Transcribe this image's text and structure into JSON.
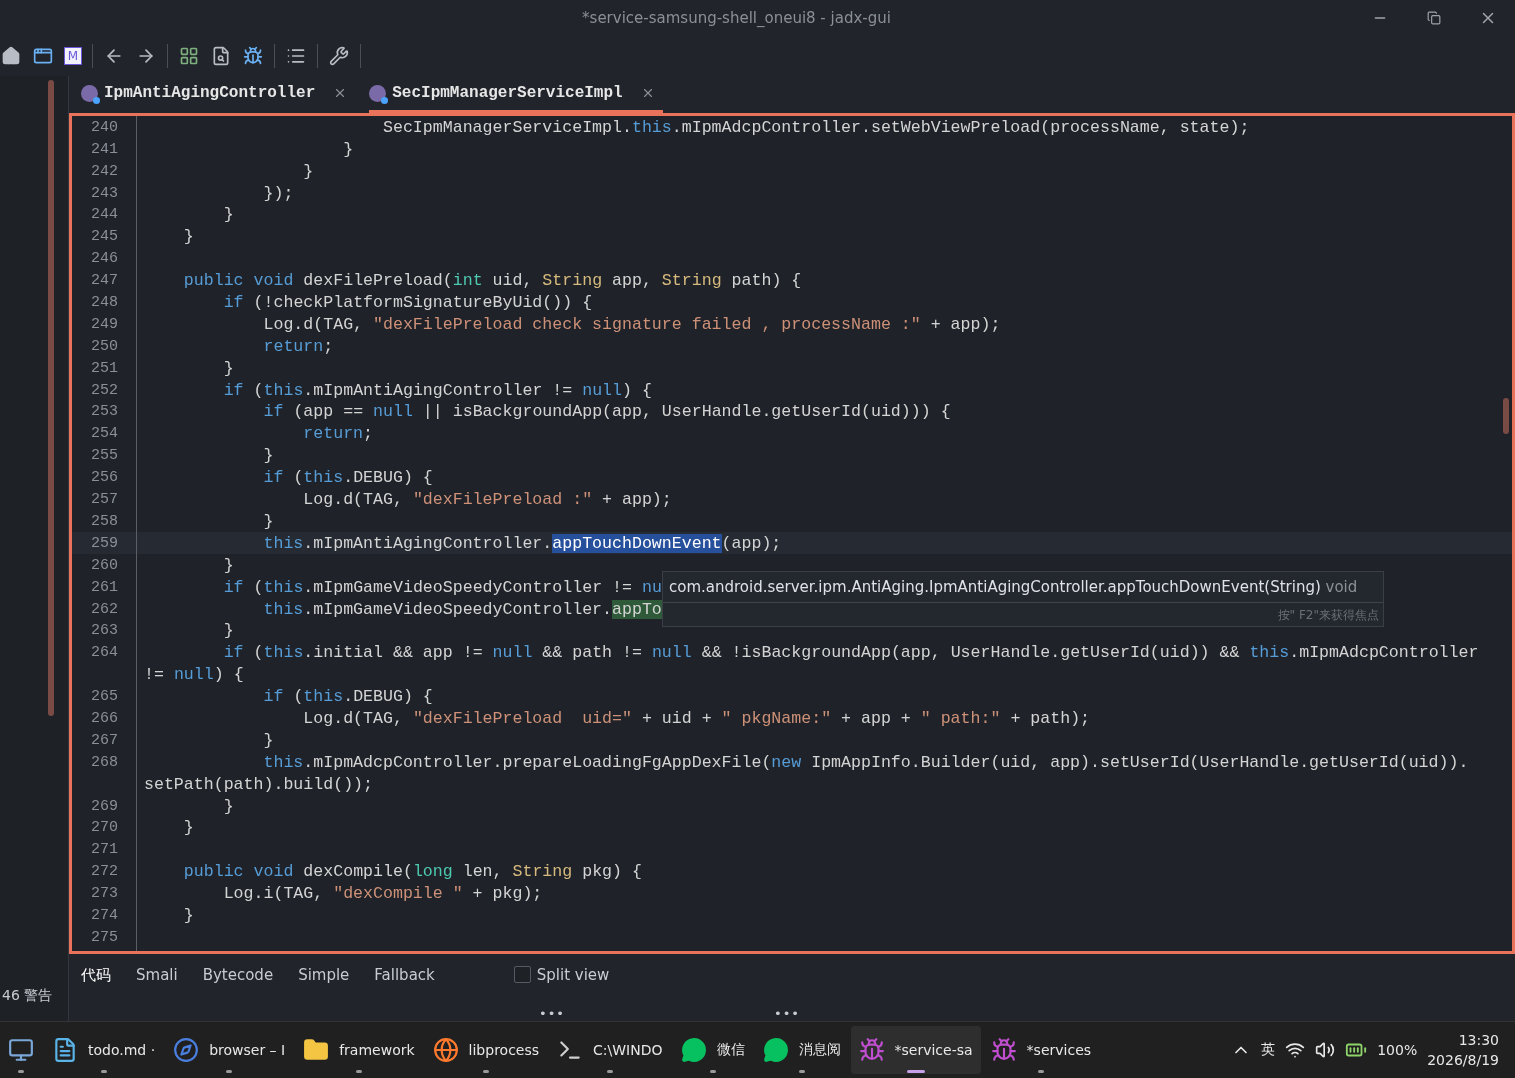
{
  "window": {
    "title": "*service-samsung-shell_oneui8 - jadx-gui"
  },
  "toolbar": [
    {
      "kind": "home"
    },
    {
      "kind": "window"
    },
    {
      "kind": "letter",
      "text": "M"
    },
    {
      "kind": "sep"
    },
    {
      "kind": "back"
    },
    {
      "kind": "forward"
    },
    {
      "kind": "sep"
    },
    {
      "kind": "grid"
    },
    {
      "kind": "search"
    },
    {
      "kind": "bug"
    },
    {
      "kind": "sep"
    },
    {
      "kind": "list"
    },
    {
      "kind": "sep"
    },
    {
      "kind": "wrench"
    },
    {
      "kind": "sep"
    }
  ],
  "tabs": [
    {
      "label": "IpmAntiAgingController",
      "selected": false
    },
    {
      "label": "SecIpmManagerServiceImpl",
      "selected": true
    }
  ],
  "editor": {
    "lines": [
      {
        "number": "240",
        "segments": [
          {
            "kind": "plain",
            "text": "                        SecIpmManagerServiceImpl."
          },
          {
            "kind": "kw",
            "text": "this"
          },
          {
            "kind": "plain",
            "text": ".mIpmAdcpController.setWebViewPreload(processName, state);"
          }
        ]
      },
      {
        "number": "241",
        "segments": [
          {
            "kind": "plain",
            "text": "                    }"
          }
        ]
      },
      {
        "number": "242",
        "segments": [
          {
            "kind": "plain",
            "text": "                }"
          }
        ]
      },
      {
        "number": "243",
        "segments": [
          {
            "kind": "plain",
            "text": "            });"
          }
        ]
      },
      {
        "number": "244",
        "segments": [
          {
            "kind": "plain",
            "text": "        }"
          }
        ]
      },
      {
        "number": "245",
        "segments": [
          {
            "kind": "plain",
            "text": "    }"
          }
        ]
      },
      {
        "number": "246"
      },
      {
        "number": "247",
        "segments": [
          {
            "kind": "kw",
            "text": "    public"
          },
          {
            "kind": "kw",
            "text": " void"
          },
          {
            "kind": "plain",
            "text": " dexFilePreload("
          },
          {
            "kind": "prim",
            "text": "int"
          },
          {
            "kind": "plain",
            "text": " uid, "
          },
          {
            "kind": "type",
            "text": "String"
          },
          {
            "kind": "plain",
            "text": " app, "
          },
          {
            "kind": "type",
            "text": "String"
          },
          {
            "kind": "plain",
            "text": " path) {"
          }
        ]
      },
      {
        "number": "248",
        "segments": [
          {
            "kind": "kw",
            "text": "        if"
          },
          {
            "kind": "plain",
            "text": " (!checkPlatformSignatureByUid()) {"
          }
        ]
      },
      {
        "number": "249",
        "segments": [
          {
            "kind": "plain",
            "text": "            Log.d(TAG, "
          },
          {
            "kind": "str",
            "text": "\"dexFilePreload check signature failed , processName :\""
          },
          {
            "kind": "plain",
            "text": " + app);"
          }
        ]
      },
      {
        "number": "250",
        "segments": [
          {
            "kind": "kw",
            "text": "            return"
          },
          {
            "kind": "plain",
            "text": ";"
          }
        ]
      },
      {
        "number": "251",
        "segments": [
          {
            "kind": "plain",
            "text": "        }"
          }
        ]
      },
      {
        "number": "252",
        "segments": [
          {
            "kind": "kw",
            "text": "        if"
          },
          {
            "kind": "plain",
            "text": " ("
          },
          {
            "kind": "kw",
            "text": "this"
          },
          {
            "kind": "plain",
            "text": ".mIpmAntiAgingController != "
          },
          {
            "kind": "kw",
            "text": "null"
          },
          {
            "kind": "plain",
            "text": ") {"
          }
        ]
      },
      {
        "number": "253",
        "segments": [
          {
            "kind": "kw",
            "text": "            if"
          },
          {
            "kind": "plain",
            "text": " (app == "
          },
          {
            "kind": "kw",
            "text": "null"
          },
          {
            "kind": "plain",
            "text": " || isBackgroundApp(app, UserHandle.getUserId(uid))) {"
          }
        ]
      },
      {
        "number": "254",
        "segments": [
          {
            "kind": "kw",
            "text": "                return"
          },
          {
            "kind": "plain",
            "text": ";"
          }
        ]
      },
      {
        "number": "255",
        "segments": [
          {
            "kind": "plain",
            "text": "            }"
          }
        ]
      },
      {
        "number": "256",
        "segments": [
          {
            "kind": "kw",
            "text": "            if"
          },
          {
            "kind": "plain",
            "text": " ("
          },
          {
            "kind": "kw",
            "text": "this"
          },
          {
            "kind": "plain",
            "text": ".DEBUG) {"
          }
        ]
      },
      {
        "number": "257",
        "segments": [
          {
            "kind": "plain",
            "text": "                Log.d(TAG, "
          },
          {
            "kind": "str",
            "text": "\"dexFilePreload :\""
          },
          {
            "kind": "plain",
            "text": " + app);"
          }
        ]
      },
      {
        "number": "258",
        "segments": [
          {
            "kind": "plain",
            "text": "            }"
          }
        ]
      },
      {
        "number": "259",
        "segments": [
          {
            "kind": "kw",
            "text": "            this"
          },
          {
            "kind": "plain",
            "text": ".mIpmAntiAgingController."
          },
          {
            "kind": "sel",
            "text": "appTouchDownEvent"
          },
          {
            "kind": "plain",
            "text": "(app);"
          }
        ]
      },
      {
        "number": "260",
        "segments": [
          {
            "kind": "plain",
            "text": "        }"
          }
        ]
      },
      {
        "number": "261",
        "segments": [
          {
            "kind": "kw",
            "text": "        if"
          },
          {
            "kind": "plain",
            "text": " ("
          },
          {
            "kind": "kw",
            "text": "this"
          },
          {
            "kind": "plain",
            "text": ".mIpmGameVideoSpeedyController != "
          },
          {
            "kind": "kw",
            "text": "nu"
          }
        ]
      },
      {
        "number": "262",
        "segments": [
          {
            "kind": "kw",
            "text": "            this"
          },
          {
            "kind": "plain",
            "text": ".mIpmGameVideoSpeedyController."
          },
          {
            "kind": "match",
            "text": "appTo"
          }
        ]
      },
      {
        "number": "263",
        "segments": [
          {
            "kind": "plain",
            "text": "        }"
          }
        ]
      },
      {
        "number": "264",
        "segments": [
          {
            "kind": "kw",
            "text": "        if"
          },
          {
            "kind": "plain",
            "text": " ("
          },
          {
            "kind": "kw",
            "text": "this"
          },
          {
            "kind": "plain",
            "text": ".initial && app != "
          },
          {
            "kind": "kw",
            "text": "null"
          },
          {
            "kind": "plain",
            "text": " && path != "
          },
          {
            "kind": "kw",
            "text": "null"
          },
          {
            "kind": "plain",
            "text": " && !isBackgroundApp(app, UserHandle.getUserId(uid)) && "
          },
          {
            "kind": "kw",
            "text": "this"
          },
          {
            "kind": "plain",
            "text": ".mIpmAdcpController"
          }
        ]
      },
      {
        "segments": [
          {
            "kind": "plain",
            "text": "!= "
          },
          {
            "kind": "kw",
            "text": "null"
          },
          {
            "kind": "plain",
            "text": ") {"
          }
        ]
      },
      {
        "number": "265",
        "segments": [
          {
            "kind": "kw",
            "text": "            if"
          },
          {
            "kind": "plain",
            "text": " ("
          },
          {
            "kind": "kw",
            "text": "this"
          },
          {
            "kind": "plain",
            "text": ".DEBUG) {"
          }
        ]
      },
      {
        "number": "266",
        "segments": [
          {
            "kind": "plain",
            "text": "                Log.d(TAG, "
          },
          {
            "kind": "str",
            "text": "\"dexFilePreload  uid=\""
          },
          {
            "kind": "plain",
            "text": " + uid + "
          },
          {
            "kind": "str",
            "text": "\" pkgName:\""
          },
          {
            "kind": "plain",
            "text": " + app + "
          },
          {
            "kind": "str",
            "text": "\" path:\""
          },
          {
            "kind": "plain",
            "text": " + path);"
          }
        ]
      },
      {
        "number": "267",
        "segments": [
          {
            "kind": "plain",
            "text": "            }"
          }
        ]
      },
      {
        "number": "268",
        "segments": [
          {
            "kind": "kw",
            "text": "            this"
          },
          {
            "kind": "plain",
            "text": ".mIpmAdcpController.prepareLoadingFgAppDexFile("
          },
          {
            "kind": "kw",
            "text": "new"
          },
          {
            "kind": "plain",
            "text": " IpmAppInfo.Builder(uid, app).setUserId(UserHandle.getUserId(uid))."
          }
        ]
      },
      {
        "segments": [
          {
            "kind": "plain",
            "text": "setPath(path).build());"
          }
        ]
      },
      {
        "number": "269",
        "segments": [
          {
            "kind": "plain",
            "text": "        }"
          }
        ]
      },
      {
        "number": "270",
        "segments": [
          {
            "kind": "plain",
            "text": "    }"
          }
        ]
      },
      {
        "number": "271"
      },
      {
        "number": "272",
        "segments": [
          {
            "kind": "kw",
            "text": "    public"
          },
          {
            "kind": "kw",
            "text": " void"
          },
          {
            "kind": "plain",
            "text": " dexCompile("
          },
          {
            "kind": "prim",
            "text": "long"
          },
          {
            "kind": "plain",
            "text": " len, "
          },
          {
            "kind": "type",
            "text": "String"
          },
          {
            "kind": "plain",
            "text": " pkg) {"
          }
        ]
      },
      {
        "number": "273",
        "segments": [
          {
            "kind": "plain",
            "text": "        Log.i(TAG, "
          },
          {
            "kind": "str",
            "text": "\"dexCompile \""
          },
          {
            "kind": "plain",
            "text": " + pkg);"
          }
        ]
      },
      {
        "number": "274",
        "segments": [
          {
            "kind": "plain",
            "text": "    }"
          }
        ]
      },
      {
        "number": "275"
      }
    ]
  },
  "tooltip": {
    "signature": "com.android.server.ipm.AntiAging.IpmAntiAgingController.appTouchDownEvent(String)",
    "return_type": "void",
    "hint": "按\" F2\"来获得焦点"
  },
  "warnings": "46 警告",
  "view_tabs": [
    {
      "label": "代码",
      "selected": true
    },
    {
      "label": "Smali",
      "selected": false
    },
    {
      "label": "Bytecode",
      "selected": false
    },
    {
      "label": "Simple",
      "selected": false
    },
    {
      "label": "Fallback",
      "selected": false
    }
  ],
  "split_view": {
    "label": "Split view",
    "checked": false
  },
  "more_handles": [
    "•••",
    "•••"
  ],
  "taskbar": [
    {
      "kind": "network",
      "selected": false
    },
    {
      "kind": "notepad",
      "label": "todo.md ·",
      "selected": false
    },
    {
      "kind": "studio",
      "label": "browser – I",
      "selected": false
    },
    {
      "kind": "folder",
      "label": "framework",
      "selected": false
    },
    {
      "kind": "firefox",
      "label": "libprocess",
      "selected": false
    },
    {
      "kind": "terminal",
      "label": "C:\\WINDO",
      "selected": false
    },
    {
      "kind": "chat",
      "label": "微信",
      "selected": false
    },
    {
      "kind": "chat",
      "label": "消息阅",
      "selected": false
    },
    {
      "kind": "jadx",
      "label": "*service-sa",
      "selected": true
    },
    {
      "kind": "jadx",
      "label": "*services",
      "selected": false
    }
  ],
  "tray": {
    "ime": "英",
    "battery": "100%",
    "time": "13:30",
    "date": "2026/8/19"
  }
}
